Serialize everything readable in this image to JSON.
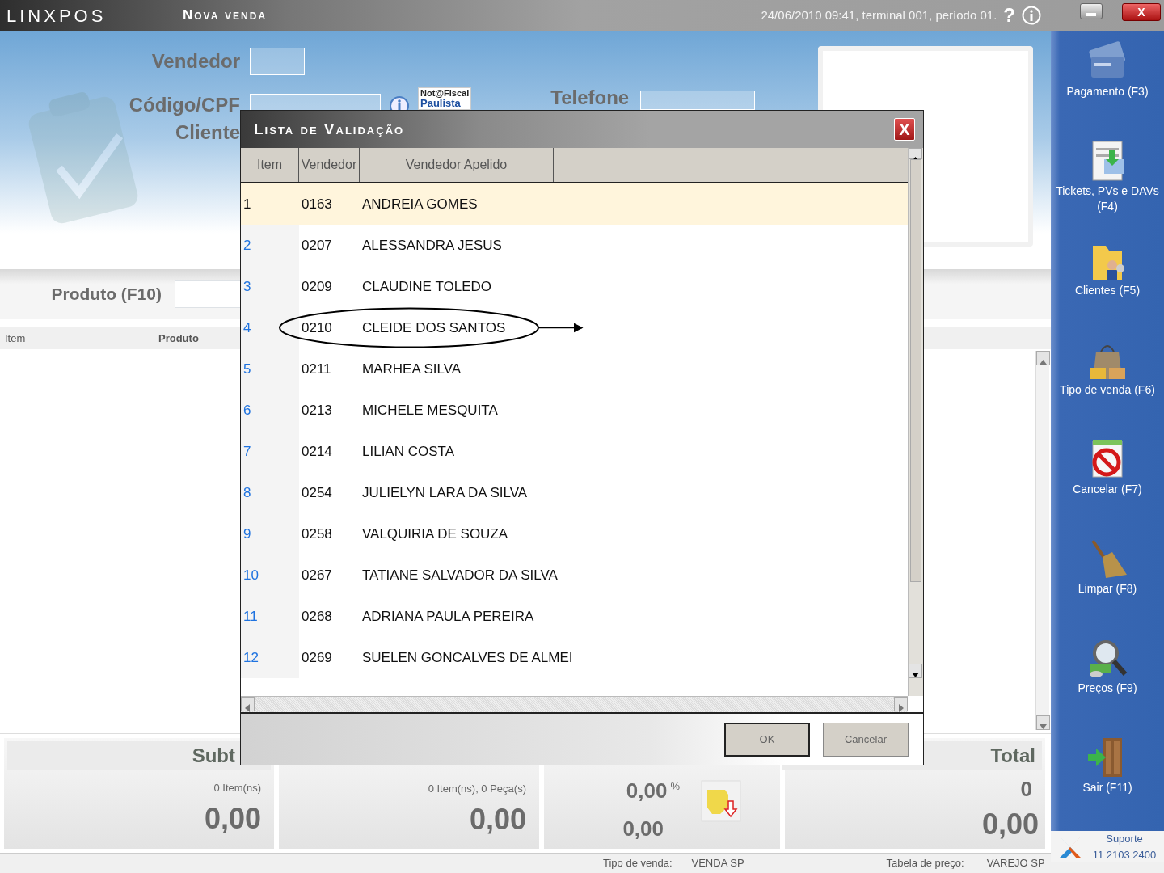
{
  "app": {
    "logo": "LINXPOS",
    "title": "Nova venda",
    "session": "24/06/2010 09:41, terminal 001, período 01.",
    "help": "?",
    "window_close": "X"
  },
  "form": {
    "vendedor_label": "Vendedor",
    "codigo_label": "Código/CPF",
    "cliente_label": "Cliente",
    "telefone_label": "Telefone",
    "nfp_logo": {
      "line1": "Not@Fiscal",
      "line2": "Paulista"
    }
  },
  "produto": {
    "label": "Produto (F10)"
  },
  "grid": {
    "columns": [
      "Item",
      "Produto"
    ]
  },
  "totals": {
    "subtotal": {
      "title": "Subt",
      "count": "0 Item(ns)",
      "value": "0,00"
    },
    "items": {
      "count": "0 Item(ns), 0 Peça(s)",
      "value": "0,00"
    },
    "discount": {
      "percent": "0,00",
      "percent_sign": "%",
      "value": "0,00"
    },
    "total": {
      "title": "Total",
      "count": "0",
      "value": "0,00"
    }
  },
  "status_bar": {
    "sale_type_label": "Tipo de venda:",
    "sale_type": "VENDA SP",
    "price_table_label": "Tabela de preço:",
    "price_table": "VAREJO SP"
  },
  "sidebar": {
    "items": [
      {
        "label": "Pagamento (F3)"
      },
      {
        "label": "Tickets, PVs e DAVs (F4)"
      },
      {
        "label": "Clientes (F5)"
      },
      {
        "label": "Tipo de venda (F6)"
      },
      {
        "label": "Cancelar (F7)"
      },
      {
        "label": "Limpar (F8)"
      },
      {
        "label": "Preços (F9)"
      },
      {
        "label": "Sair (F11)"
      }
    ],
    "support": {
      "label": "Suporte",
      "phone": "11 2103 2400"
    }
  },
  "dialog": {
    "title": "Lista de Validação",
    "close": "X",
    "columns": [
      "Item",
      "Vendedor",
      "Vendedor Apelido"
    ],
    "rows": [
      {
        "item": "1",
        "code": "0163",
        "name": "ANDREIA GOMES",
        "selected": true,
        "circled": false
      },
      {
        "item": "2",
        "code": "0207",
        "name": "ALESSANDRA JESUS",
        "selected": false,
        "circled": false
      },
      {
        "item": "3",
        "code": "0209",
        "name": "CLAUDINE TOLEDO",
        "selected": false,
        "circled": false
      },
      {
        "item": "4",
        "code": "0210",
        "name": "CLEIDE DOS SANTOS",
        "selected": false,
        "circled": true
      },
      {
        "item": "5",
        "code": "0211",
        "name": "MARHEA SILVA",
        "selected": false,
        "circled": false
      },
      {
        "item": "6",
        "code": "0213",
        "name": "MICHELE MESQUITA",
        "selected": false,
        "circled": false
      },
      {
        "item": "7",
        "code": "0214",
        "name": "LILIAN COSTA",
        "selected": false,
        "circled": false
      },
      {
        "item": "8",
        "code": "0254",
        "name": "JULIELYN LARA DA SILVA",
        "selected": false,
        "circled": false
      },
      {
        "item": "9",
        "code": "0258",
        "name": "VALQUIRIA DE SOUZA",
        "selected": false,
        "circled": false
      },
      {
        "item": "10",
        "code": "0267",
        "name": "TATIANE SALVADOR DA SILVA",
        "selected": false,
        "circled": false
      },
      {
        "item": "11",
        "code": "0268",
        "name": "ADRIANA PAULA PEREIRA",
        "selected": false,
        "circled": false
      },
      {
        "item": "12",
        "code": "0269",
        "name": "SUELEN GONCALVES DE ALMEI",
        "selected": false,
        "circled": false
      }
    ],
    "buttons": [
      {
        "label": "OK",
        "default": true
      },
      {
        "label": "Cancelar",
        "default": false
      }
    ]
  }
}
